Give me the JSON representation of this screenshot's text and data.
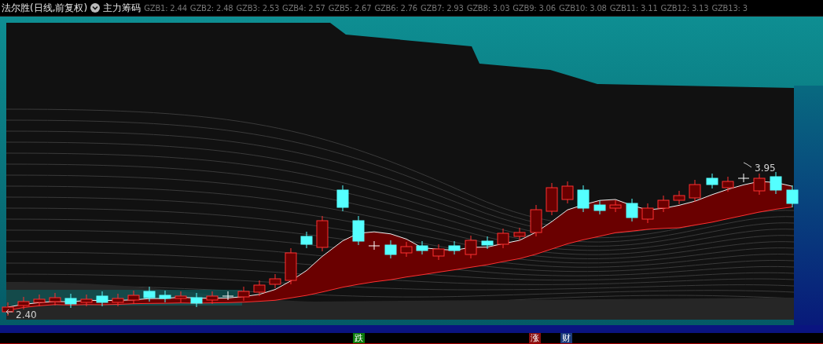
{
  "header": {
    "title": "法尔胜(日线,前复权)",
    "indicator": "主力筹码",
    "gzb": [
      {
        "label": "GZB1:",
        "value": "2.44"
      },
      {
        "label": "GZB2:",
        "value": "2.48"
      },
      {
        "label": "GZB3:",
        "value": "2.53"
      },
      {
        "label": "GZB4:",
        "value": "2.57"
      },
      {
        "label": "GZB5:",
        "value": "2.67"
      },
      {
        "label": "GZB6:",
        "value": "2.76"
      },
      {
        "label": "GZB7:",
        "value": "2.93"
      },
      {
        "label": "GZB8:",
        "value": "3.03"
      },
      {
        "label": "GZB9:",
        "value": "3.06"
      },
      {
        "label": "GZB10:",
        "value": "3.08"
      },
      {
        "label": "GZB11:",
        "value": "3.11"
      },
      {
        "label": "GZB12:",
        "value": "3.13"
      },
      {
        "label": "GZB13:",
        "value": "3"
      }
    ]
  },
  "chart": {
    "high_label": "3.95",
    "low_label": "2.40"
  },
  "markers": [
    {
      "text": "跌",
      "color": "#0a7a0a"
    },
    {
      "text": "涨",
      "color": "#8a1010"
    },
    {
      "text": "财",
      "color": "#1c3c7c"
    }
  ]
}
